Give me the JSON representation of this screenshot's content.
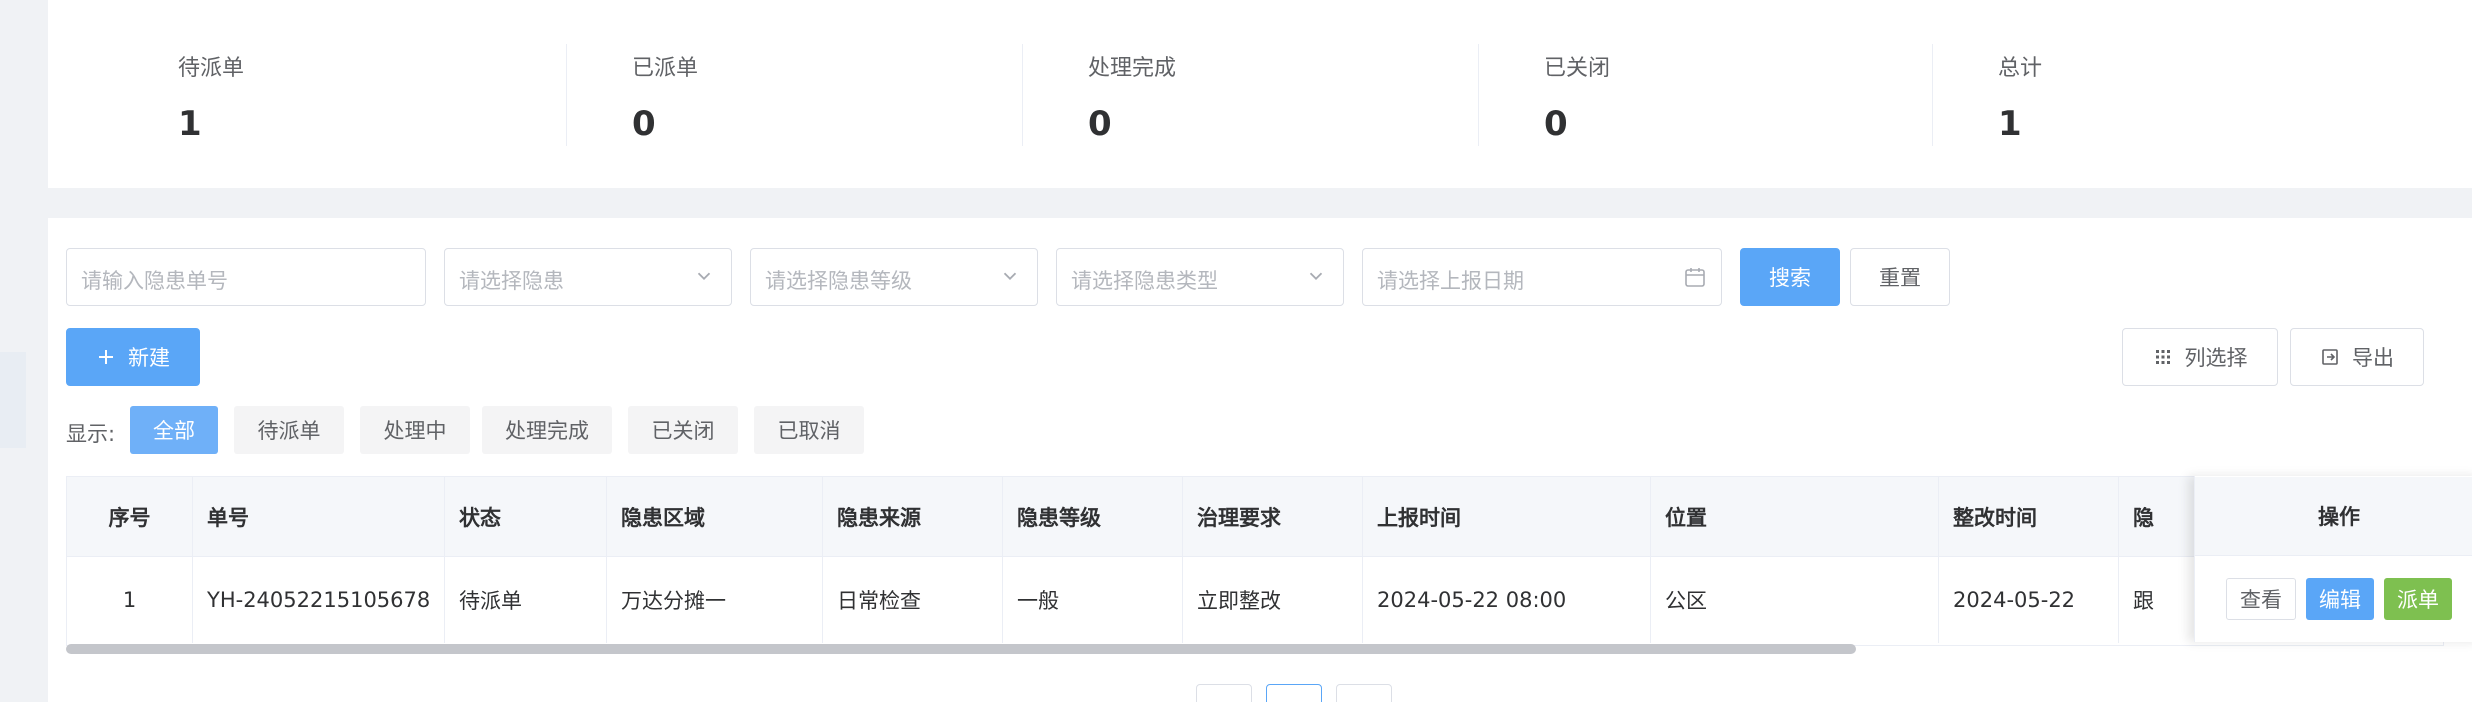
{
  "stats": [
    {
      "label": "待派单",
      "value": "1"
    },
    {
      "label": "已派单",
      "value": "0"
    },
    {
      "label": "处理完成",
      "value": "0"
    },
    {
      "label": "已关闭",
      "value": "0"
    },
    {
      "label": "总计",
      "value": "1"
    }
  ],
  "filters": {
    "order_no_placeholder": "请输入隐患单号",
    "hazard_placeholder": "请选择隐患",
    "level_placeholder": "请选择隐患等级",
    "type_placeholder": "请选择隐患类型",
    "date_placeholder": "请选择上报日期",
    "search_label": "搜索",
    "reset_label": "重置"
  },
  "toolbar": {
    "new_label": "新建",
    "columns_label": "列选择",
    "export_label": "导出"
  },
  "display": {
    "label": "显示:",
    "chips": [
      "全部",
      "待派单",
      "处理中",
      "处理完成",
      "已关闭",
      "已取消"
    ]
  },
  "table": {
    "headers": [
      "序号",
      "单号",
      "状态",
      "隐患区域",
      "隐患来源",
      "隐患等级",
      "治理要求",
      "上报时间",
      "位置",
      "整改时间",
      "隐"
    ],
    "rows": [
      [
        "1",
        "YH-24052215105678",
        "待派单",
        "万达分摊一",
        "日常检查",
        "一般",
        "立即整改",
        "2024-05-22 08:00",
        "公区",
        "2024-05-22",
        "跟"
      ]
    ],
    "ops_header": "操作",
    "ops": {
      "view": "查看",
      "edit": "编辑",
      "dispatch": "派单"
    }
  },
  "colors": {
    "primary": "#5aa6f7",
    "success": "#7ec050",
    "chip_active": "#6fb0f8"
  },
  "icons": [
    "chevron-down-icon",
    "calendar-icon",
    "plus-icon",
    "grid-icon",
    "export-icon"
  ]
}
